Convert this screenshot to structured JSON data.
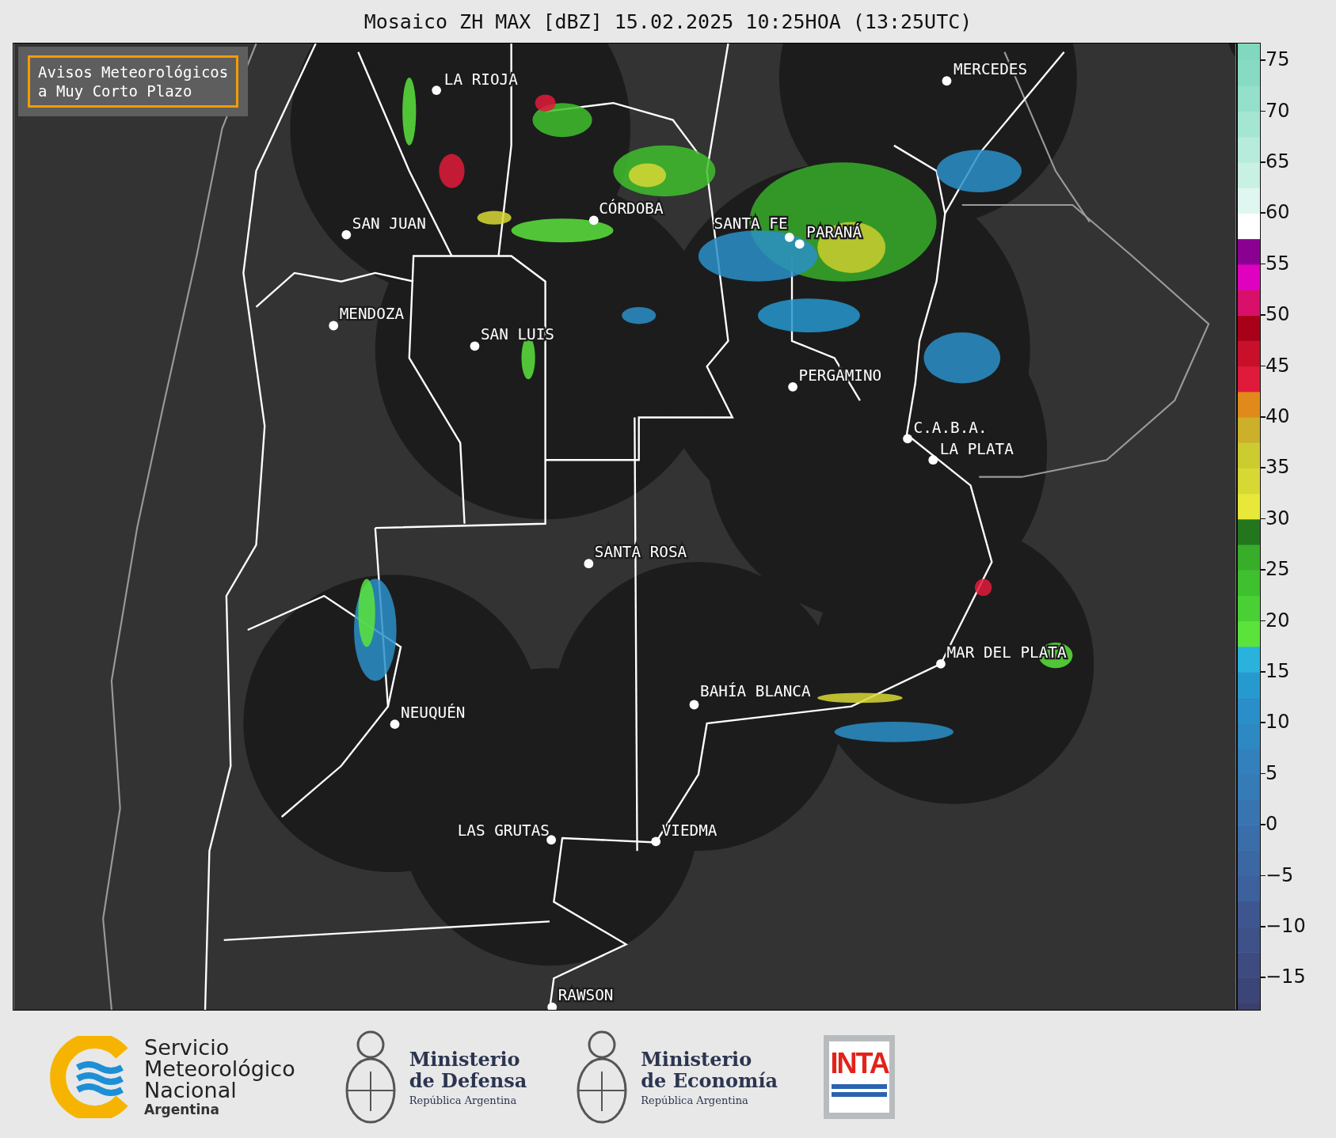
{
  "title": "Mosaico ZH MAX [dBZ] 15.02.2025 10:25HOA (13:25UTC)",
  "notice": "Avisos Meteorológicos\na Muy Corto Plazo",
  "cities": [
    {
      "name": "LA RIOJA"
    },
    {
      "name": "MERCEDES"
    },
    {
      "name": "SAN JUAN"
    },
    {
      "name": "CÓRDOBA"
    },
    {
      "name": "SANTA FE"
    },
    {
      "name": "PARANÁ"
    },
    {
      "name": "MENDOZA"
    },
    {
      "name": "SAN LUIS"
    },
    {
      "name": "PERGAMINO"
    },
    {
      "name": "C.A.B.A."
    },
    {
      "name": "LA PLATA"
    },
    {
      "name": "SANTA ROSA"
    },
    {
      "name": "MAR DEL PLATA"
    },
    {
      "name": "BAHÍA BLANCA"
    },
    {
      "name": "NEUQUÉN"
    },
    {
      "name": "LAS GRUTAS"
    },
    {
      "name": "VIEDMA"
    },
    {
      "name": "RAWSON"
    }
  ],
  "colorbar": {
    "ticks": [
      "75",
      "70",
      "65",
      "60",
      "55",
      "50",
      "45",
      "40",
      "35",
      "30",
      "25",
      "20",
      "15",
      "10",
      "5",
      "0",
      "−5",
      "−10",
      "−15"
    ],
    "bands": [
      {
        "color": "#3a3f6e"
      },
      {
        "color": "#3c4577"
      },
      {
        "color": "#3d4b80"
      },
      {
        "color": "#3e5188"
      },
      {
        "color": "#3e5690"
      },
      {
        "color": "#3d619c"
      },
      {
        "color": "#3b68a3"
      },
      {
        "color": "#3a6eaa"
      },
      {
        "color": "#3874b0"
      },
      {
        "color": "#357bb6"
      },
      {
        "color": "#3281bc"
      },
      {
        "color": "#2e88c2"
      },
      {
        "color": "#2a8fc8"
      },
      {
        "color": "#269ace"
      },
      {
        "color": "#2ab2dc"
      },
      {
        "color": "#5be33c"
      },
      {
        "color": "#4ad034"
      },
      {
        "color": "#3fc02e"
      },
      {
        "color": "#37ad29"
      },
      {
        "color": "#23761e"
      },
      {
        "color": "#e8e83a"
      },
      {
        "color": "#d8d835"
      },
      {
        "color": "#cccc30"
      },
      {
        "color": "#ccb02a"
      },
      {
        "color": "#e08a1c"
      },
      {
        "color": "#e01a3a"
      },
      {
        "color": "#c8102a"
      },
      {
        "color": "#a80018"
      },
      {
        "color": "#d8106a"
      },
      {
        "color": "#e000c0"
      },
      {
        "color": "#8a0090"
      },
      {
        "color": "#ffffff"
      },
      {
        "color": "#dff7f0"
      },
      {
        "color": "#c8f0e3"
      },
      {
        "color": "#b7ebdb"
      },
      {
        "color": "#a5e6d3"
      },
      {
        "color": "#94e0ca"
      },
      {
        "color": "#88dbc3"
      },
      {
        "color": "#80d8bf"
      }
    ]
  },
  "logos": [
    {
      "kind": "smn",
      "lines": [
        "Servicio",
        "Meteorológico",
        "Nacional"
      ],
      "subtitle": "Argentina"
    },
    {
      "kind": "ministry",
      "title": "Ministerio",
      "subtitle": "de Defensa",
      "caption": "República Argentina"
    },
    {
      "kind": "ministry",
      "title": "Ministerio",
      "subtitle": "de Economía",
      "caption": "República Argentina"
    },
    {
      "kind": "inta",
      "text": "INTA"
    }
  ]
}
